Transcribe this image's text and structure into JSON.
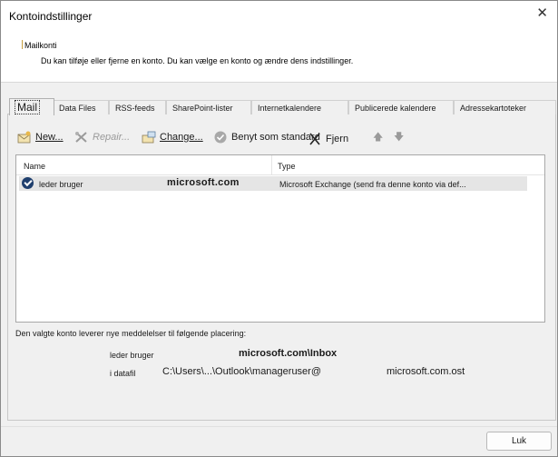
{
  "window": {
    "title": "Kontoindstillinger",
    "close_glyph": "✕"
  },
  "header": {
    "heading": "Mailkonti",
    "description": "Du kan tilføje eller fjerne en konto. Du kan vælge en konto og ændre dens indstillinger."
  },
  "tabs": [
    {
      "label": "Mail"
    },
    {
      "label": "Data Files"
    },
    {
      "label": "RSS-feeds"
    },
    {
      "label": "SharePoint-lister"
    },
    {
      "label": "Internetkalendere"
    },
    {
      "label": "Publicerede kalendere"
    },
    {
      "label": "Adressekartoteker"
    }
  ],
  "toolbar": {
    "new_label": "New...",
    "repair_label": "Repair...",
    "change_label": "Change...",
    "default_label": "Benyt som standard",
    "remove_label": "Fjern",
    "up_glyph": "🡅",
    "down_glyph": "🡇"
  },
  "list": {
    "columns": {
      "name": "Name",
      "type": "Type"
    },
    "rows": [
      {
        "name": "leder bruger",
        "email": "microsoft.com",
        "type": "Microsoft Exchange (send fra denne konto via def..."
      }
    ]
  },
  "delivery": {
    "text": "Den valgte konto leverer nye meddelelser til følgende placering:",
    "label1": "leder bruger",
    "value1": "microsoft.com\\Inbox",
    "label2": "i datafil",
    "value2a": "C:\\Users\\...\\Outlook\\manageruser@",
    "value2b": "microsoft.com.ost"
  },
  "footer": {
    "close_label": "Luk"
  }
}
